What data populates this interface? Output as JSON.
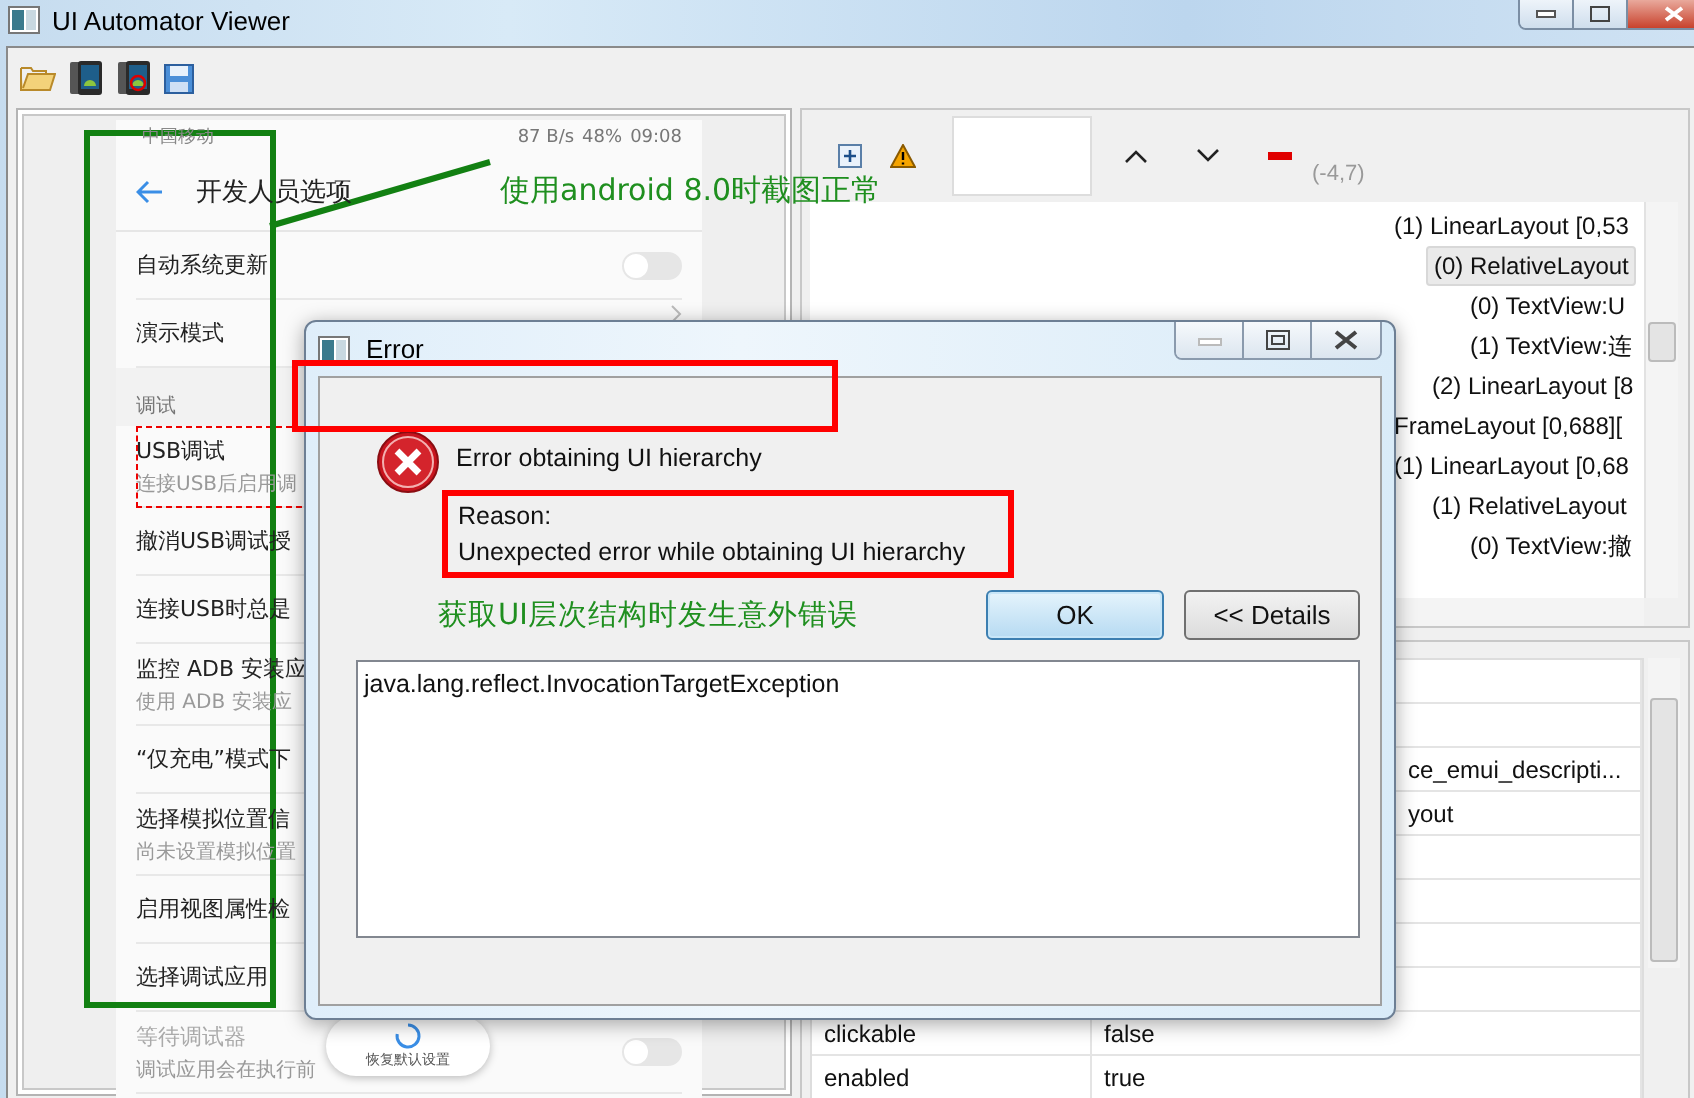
{
  "window": {
    "title": "UI Automator Viewer"
  },
  "device_screen": {
    "status_bar": {
      "carrier": "中国移动",
      "network_speed": "87 B/s",
      "battery": "48%",
      "time": "09:08"
    },
    "title": "开发人员选项",
    "settings": [
      {
        "kind": "toggle",
        "title": "自动系统更新",
        "on": false,
        "selected": false,
        "disabled": false
      },
      {
        "kind": "link",
        "title": "演示模式",
        "selected": false,
        "disabled": false
      },
      {
        "kind": "section",
        "title": "调试"
      },
      {
        "kind": "item",
        "title": "USB调试",
        "subtitle": "连接USB后启用调",
        "selected": true,
        "disabled": false
      },
      {
        "kind": "item",
        "title": "撤消USB调试授",
        "selected": false,
        "disabled": false
      },
      {
        "kind": "item",
        "title": "连接USB时总是",
        "selected": false,
        "disabled": false
      },
      {
        "kind": "item",
        "title": "监控 ADB 安装应",
        "subtitle": "使用 ADB 安装应",
        "selected": false,
        "disabled": false
      },
      {
        "kind": "item",
        "title": "“仅充电”模式下",
        "selected": false,
        "disabled": false
      },
      {
        "kind": "item",
        "title": "选择模拟位置信",
        "subtitle": "尚未设置模拟位置",
        "selected": false,
        "disabled": false
      },
      {
        "kind": "item",
        "title": "启用视图属性检",
        "selected": false,
        "disabled": false
      },
      {
        "kind": "item",
        "title": "选择调试应用",
        "selected": false,
        "disabled": false
      },
      {
        "kind": "toggle",
        "title": "等待调试器",
        "subtitle": "调试应用会在执行前",
        "on": false,
        "selected": false,
        "disabled": true
      }
    ],
    "floating_button": {
      "label": "恢复默认设置"
    }
  },
  "annotations": {
    "screenshot_note": "使用android 8.0时截图正常",
    "dialog_note": "获取UI层次结构时发生意外错误"
  },
  "inspector": {
    "coordinates": "(-4,7)",
    "tree": [
      {
        "label": "(1) LinearLayout [0,53",
        "selected": false,
        "children": [
          {
            "label": "(0) RelativeLayout",
            "selected": true,
            "children": [
              {
                "label": "(0) TextView:U",
                "selected": false
              },
              {
                "label": "(1) TextView:连",
                "selected": false
              }
            ]
          },
          {
            "label": "(2) LinearLayout [8",
            "selected": false
          }
        ]
      },
      {
        "label": "FrameLayout [0,688][",
        "selected": false
      },
      {
        "label": "(1) LinearLayout [0,68",
        "selected": false,
        "children": [
          {
            "label": "(1) RelativeLayout",
            "selected": false,
            "children": [
              {
                "label": "(0) TextView:撤",
                "selected": false
              }
            ]
          }
        ]
      }
    ],
    "properties": [
      {
        "value": "ce_emui_descripti..."
      },
      {
        "value": "yout"
      },
      {
        "property": "clickable",
        "value": "false"
      },
      {
        "property": "enabled",
        "value": "true"
      }
    ]
  },
  "dialog": {
    "title": "Error",
    "message": "Error obtaining UI hierarchy",
    "reason_label": "Reason:",
    "reason": "Unexpected error while obtaining UI hierarchy",
    "buttons": [
      {
        "label": "OK",
        "default": true
      },
      {
        "label": "<< Details",
        "default": false
      }
    ],
    "details": "java.lang.reflect.InvocationTargetException"
  }
}
